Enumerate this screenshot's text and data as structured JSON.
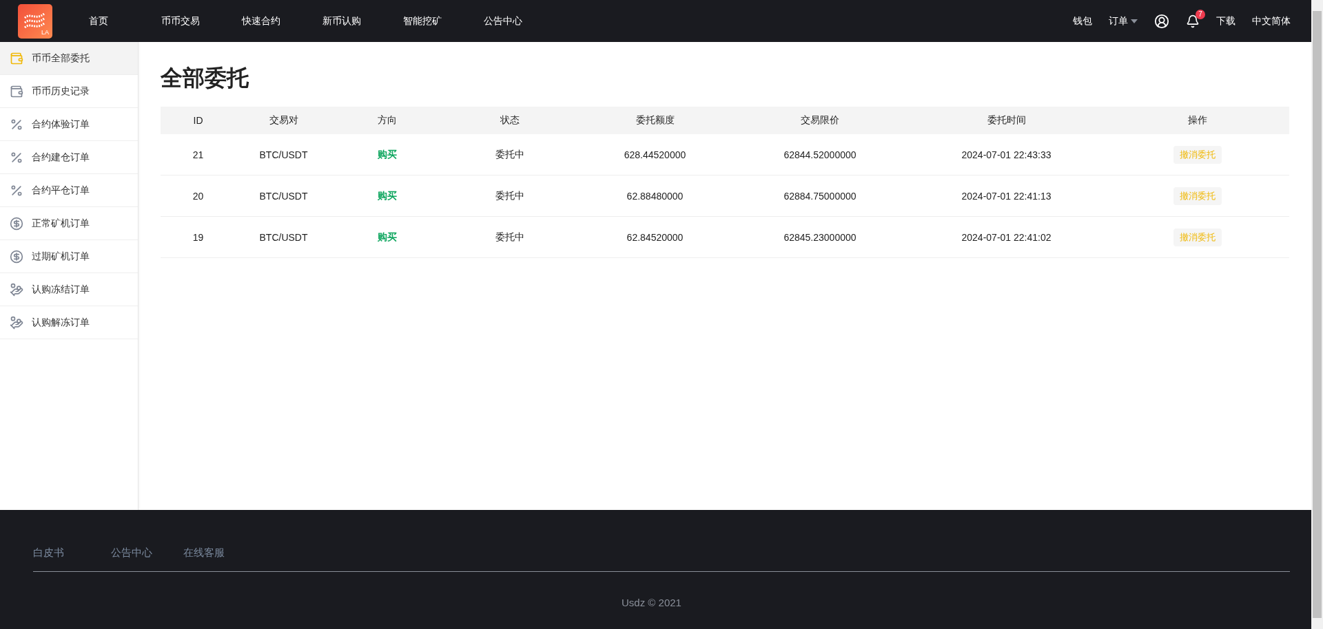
{
  "header": {
    "logo": {
      "text": "LA"
    },
    "nav": [
      {
        "label": "首页"
      },
      {
        "label": "币币交易"
      },
      {
        "label": "快速合约"
      },
      {
        "label": "新币认购"
      },
      {
        "label": "智能挖矿"
      },
      {
        "label": "公告中心"
      }
    ],
    "wallet": "钱包",
    "orders": "订单",
    "notifications": "7",
    "download": "下载",
    "language": "中文简体"
  },
  "sidebar": {
    "items": [
      {
        "label": "币币全部委托",
        "kind": "spot",
        "selected": true
      },
      {
        "label": "币币历史记录",
        "kind": "spot",
        "selected": false
      },
      {
        "label": "合约体验订单",
        "kind": "contract",
        "selected": false
      },
      {
        "label": "合约建仓订单",
        "kind": "contract",
        "selected": false
      },
      {
        "label": "合约平仓订单",
        "kind": "contract",
        "selected": false
      },
      {
        "label": "正常矿机订单",
        "kind": "mining",
        "selected": false
      },
      {
        "label": "过期矿机订单",
        "kind": "mining",
        "selected": false
      },
      {
        "label": "认购冻结订单",
        "kind": "subscription",
        "selected": false
      },
      {
        "label": "认购解冻订单",
        "kind": "subscription",
        "selected": false
      }
    ]
  },
  "page_title": "全部委托",
  "table": {
    "columns": [
      "ID",
      "交易对",
      "方向",
      "状态",
      "委托额度",
      "交易限价",
      "委托时间",
      "操作"
    ],
    "rows": [
      {
        "id": "21",
        "pair": "BTC/USDT",
        "direction": "购买",
        "status": "委托中",
        "amount": "628.44520000",
        "limit_price": "62844.52000000",
        "time": "2024-07-01 22:43:33",
        "action": "撤消委托"
      },
      {
        "id": "20",
        "pair": "BTC/USDT",
        "direction": "购买",
        "status": "委托中",
        "amount": "62.88480000",
        "limit_price": "62884.75000000",
        "time": "2024-07-01 22:41:13",
        "action": "撤消委托"
      },
      {
        "id": "19",
        "pair": "BTC/USDT",
        "direction": "购买",
        "status": "委托中",
        "amount": "62.84520000",
        "limit_price": "62845.23000000",
        "time": "2024-07-01 22:41:02",
        "action": "撤消委托"
      }
    ]
  },
  "footer": {
    "links": [
      "白皮书",
      "公告中心",
      "在线客服"
    ],
    "copyright": "Usdz © 2021"
  }
}
